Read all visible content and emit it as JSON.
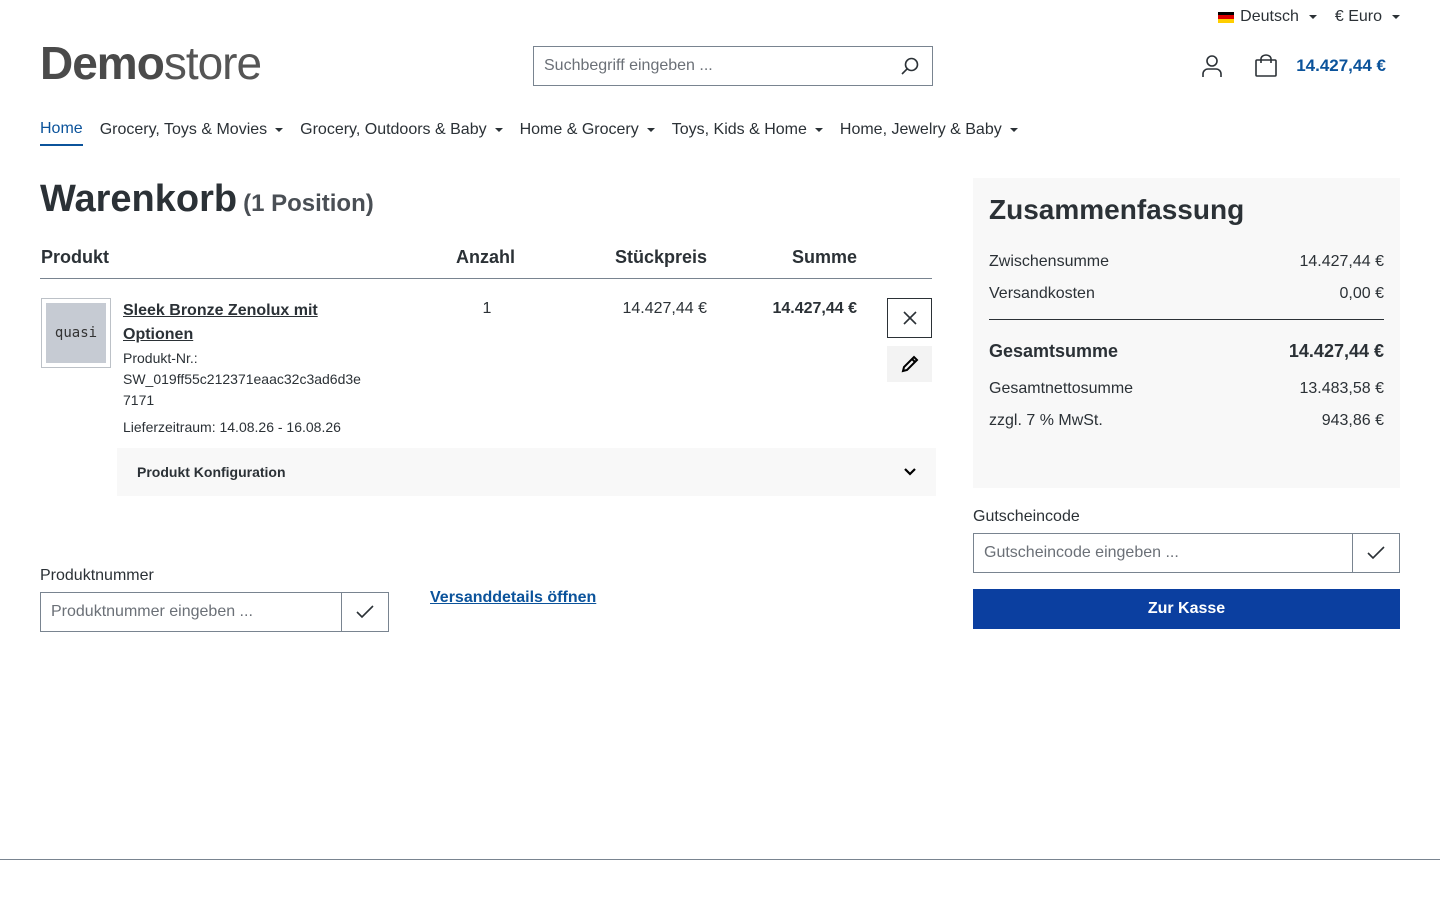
{
  "topbar": {
    "language": "Deutsch",
    "currency": "€ Euro"
  },
  "header": {
    "logo_bold": "Demo",
    "logo_light": "store",
    "search_placeholder": "Suchbegriff eingeben ...",
    "cart_total": "14.427,44 €"
  },
  "nav": {
    "items": [
      {
        "label": "Home"
      },
      {
        "label": "Grocery, Toys & Movies"
      },
      {
        "label": "Grocery, Outdoors & Baby"
      },
      {
        "label": "Home & Grocery"
      },
      {
        "label": "Toys, Kids & Home"
      },
      {
        "label": "Home, Jewelry & Baby"
      }
    ]
  },
  "cart": {
    "title": "Warenkorb",
    "count": "(1 Position)",
    "columns": {
      "product": "Produkt",
      "quantity": "Anzahl",
      "unit_price": "Stückpreis",
      "total": "Summe"
    },
    "item": {
      "thumb_text": "quasi",
      "name": "Sleek Bronze Zenolux mit Optionen",
      "number_label": "Produkt-Nr.:",
      "number": "SW_019ff55c212371eaac32c3ad6d3e7171",
      "delivery": "Lieferzeitraum: 14.08.26 - 16.08.26",
      "quantity": "1",
      "unit_price": "14.427,44 €",
      "total": "14.427,44 €",
      "config_label": "Produkt Konfiguration"
    }
  },
  "product_number_form": {
    "label": "Produktnummer",
    "placeholder": "Produktnummer eingeben ..."
  },
  "shipping_link": "Versanddetails öffnen",
  "summary": {
    "title": "Zusammenfassung",
    "subtotal_label": "Zwischensumme",
    "subtotal": "14.427,44 €",
    "shipping_label": "Versandkosten",
    "shipping": "0,00 €",
    "grand_total_label": "Gesamtsumme",
    "grand_total": "14.427,44 €",
    "net_label": "Gesamtnettosumme",
    "net": "13.483,58 €",
    "tax_label": "zzgl. 7 % MwSt.",
    "tax": "943,86 €"
  },
  "coupon": {
    "label": "Gutscheincode",
    "placeholder": "Gutscheincode eingeben ..."
  },
  "checkout_label": "Zur Kasse",
  "colors": {
    "accent": "#0b539b",
    "checkout_bg": "#0b3fa0"
  }
}
